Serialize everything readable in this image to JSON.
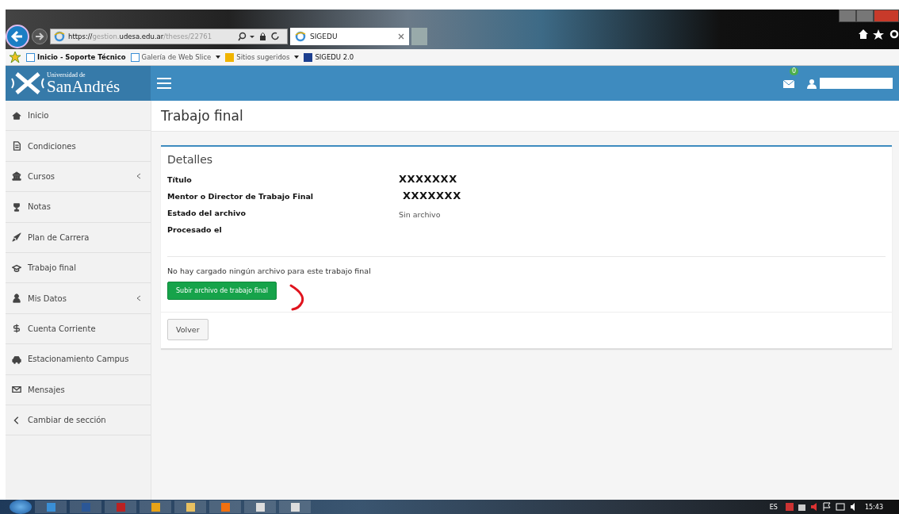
{
  "browser": {
    "url": {
      "scheme": "https://",
      "host_pre": "gestion.",
      "host": "udesa.edu.ar",
      "path": "/theses/22761"
    },
    "tabs": [
      {
        "title": "SIGEDU",
        "selected": true
      }
    ],
    "favorites": [
      {
        "label": "Inicio - Soporte Técnico",
        "kind": "page",
        "dropdown": false
      },
      {
        "label": "Galería de Web Slice",
        "kind": "page",
        "dropdown": true
      },
      {
        "label": "Sitios sugeridos",
        "kind": "bing",
        "dropdown": true
      },
      {
        "label": "SIGEDU 2.0",
        "kind": "site",
        "dropdown": false
      }
    ]
  },
  "header": {
    "logo_small": "Universidad de",
    "logo_large": "SanAndrés",
    "messages_badge": "0"
  },
  "sidebar": {
    "items": [
      {
        "label": "Inicio",
        "submenu": false
      },
      {
        "label": "Condiciones",
        "submenu": false
      },
      {
        "label": "Cursos",
        "submenu": true
      },
      {
        "label": "Notas",
        "submenu": false
      },
      {
        "label": "Plan de Carrera",
        "submenu": false
      },
      {
        "label": "Trabajo final",
        "submenu": false
      },
      {
        "label": "Mis Datos",
        "submenu": true
      },
      {
        "label": "Cuenta Corriente",
        "submenu": false
      },
      {
        "label": "Estacionamiento Campus",
        "submenu": false
      },
      {
        "label": "Mensajes",
        "submenu": false
      },
      {
        "label": "Cambiar de sección",
        "submenu": false
      }
    ]
  },
  "page_title": "Trabajo final",
  "panel": {
    "title": "Detalles",
    "fields": [
      {
        "label": "Título",
        "value": "XXXXXXX",
        "kind": "big"
      },
      {
        "label": "Mentor o Director de Trabajo Final",
        "value": "XXXXXXX",
        "kind": "big"
      },
      {
        "label": "Estado del archivo",
        "value": "Sin archivo",
        "kind": "plain"
      },
      {
        "label": "Procesado el"
      }
    ],
    "notice": "No hay cargado ningún archivo para este trabajo final",
    "upload_button": "Subir archivo de trabajo final",
    "back_button": "Volver"
  },
  "taskbar": {
    "language": "ES",
    "time": "15:43"
  }
}
